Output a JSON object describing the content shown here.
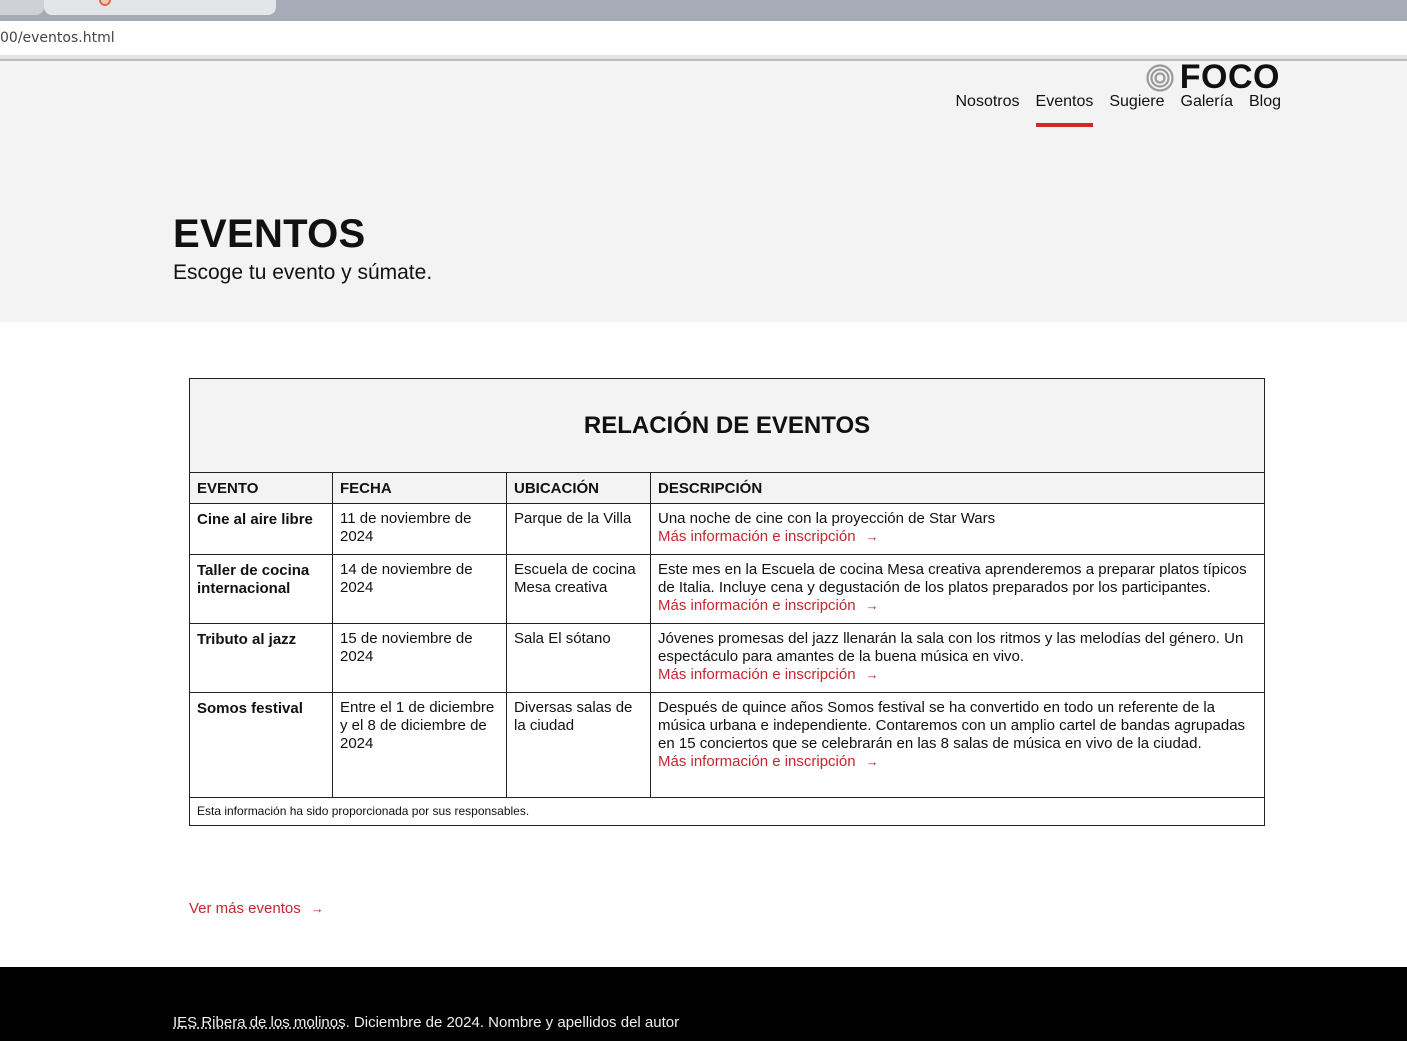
{
  "browser": {
    "url": "00/eventos.html"
  },
  "site": {
    "logo_text": "FOCO",
    "nav": [
      "Nosotros",
      "Eventos",
      "Sugiere",
      "Galería",
      "Blog"
    ],
    "active_nav": "Eventos"
  },
  "hero": {
    "title": "EVENTOS",
    "subtitle": "Escoge tu evento y súmate."
  },
  "table": {
    "caption": "RELACIÓN DE EVENTOS",
    "headers": [
      "EVENTO",
      "FECHA",
      "UBICACIÓN",
      "DESCRIPCIÓN"
    ],
    "link_label": "Más información e inscripción",
    "arrow": "→",
    "rows": [
      {
        "evento": "Cine al aire libre",
        "fecha": "11 de noviembre de 2024",
        "ubicacion": "Parque de la Villa",
        "descripcion": "Una noche de cine con la proyección de Star Wars"
      },
      {
        "evento": "Taller de cocina internacional",
        "fecha": "14 de noviembre de 2024",
        "ubicacion": "Escuela de cocina Mesa creativa",
        "descripcion": "Este mes en la Escuela de cocina Mesa creativa aprenderemos a preparar platos típicos de Italia. Incluye cena y degustación de los platos preparados por los participantes."
      },
      {
        "evento": "Tributo al jazz",
        "fecha": "15 de noviembre de 2024",
        "ubicacion": "Sala El sótano",
        "descripcion": "Jóvenes promesas del jazz llenarán la sala con los ritmos y las melodías del género. Un espectáculo para amantes de la buena música en vivo."
      },
      {
        "evento": "Somos festival",
        "fecha": "Entre el 1 de diciembre y el 8 de diciembre de 2024",
        "ubicacion": "Diversas salas de la ciudad",
        "descripcion": "Después de quince años Somos festival se ha convertido en todo un referente de la música urbana e independiente. Contaremos con un amplio cartel de bandas agrupadas en 15 conciertos que se celebrarán en las 8 salas de música en vivo de la ciudad."
      }
    ],
    "footnote": "Esta información ha sido proporcionada por sus responsables."
  },
  "ver_mas": "Ver más eventos",
  "footer": {
    "school": "IES Ribera de los molinos",
    "rest": ". Diciembre de 2024. Nombre y apellidos del autor"
  },
  "colors": {
    "accent": "#c6262e",
    "hero_bg": "#f3f3f4",
    "footer_bg": "#000000"
  }
}
